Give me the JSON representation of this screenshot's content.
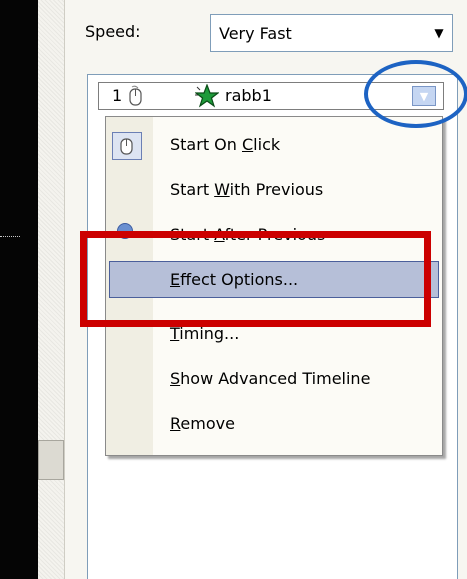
{
  "speed": {
    "label": "Speed:",
    "value": "Very Fast"
  },
  "animation_item": {
    "order": "1",
    "name": "rabb1"
  },
  "menu": {
    "items": [
      {
        "pre": "Start On ",
        "key": "C",
        "post": "lick"
      },
      {
        "pre": "Start ",
        "key": "W",
        "post": "ith Previous"
      },
      {
        "pre": "Start ",
        "key": "A",
        "post": "fter Previous"
      },
      {
        "pre": "",
        "key": "E",
        "post": "ffect Options..."
      },
      {
        "pre": "",
        "key": "T",
        "post": "iming..."
      },
      {
        "pre": "",
        "key": "S",
        "post": "how Advanced Timeline"
      },
      {
        "pre": "",
        "key": "R",
        "post": "emove"
      }
    ],
    "highlighted_index": 3
  },
  "annotations": {
    "rect_color": "#cc0000",
    "ellipse_color": "#1d63c3"
  },
  "icons": [
    "mouse-click-icon",
    "star-effect-icon",
    "dropdown-arrow-icon",
    "clock-icon"
  ]
}
